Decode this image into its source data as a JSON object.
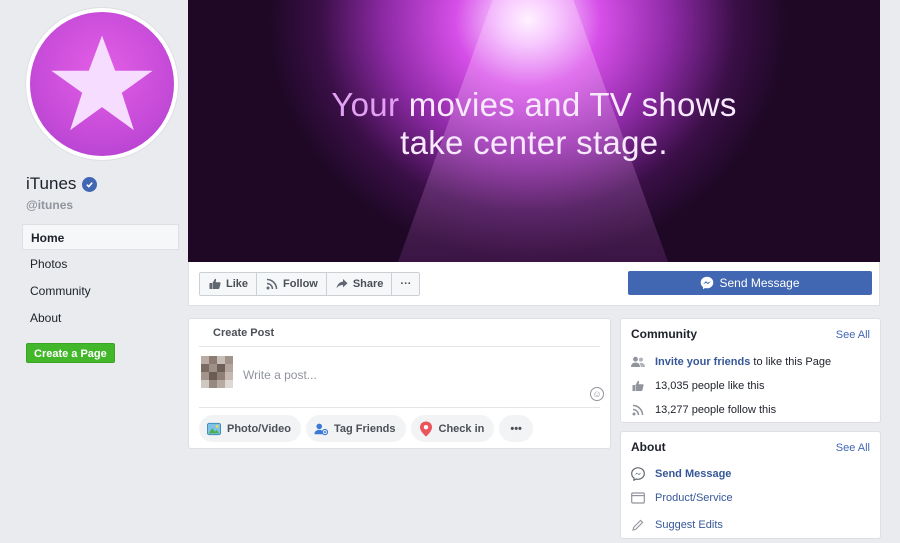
{
  "page": {
    "name": "iTunes",
    "handle": "@itunes"
  },
  "nav": {
    "items": [
      {
        "label": "Home",
        "active": true
      },
      {
        "label": "Photos"
      },
      {
        "label": "Community"
      },
      {
        "label": "About"
      }
    ],
    "create_page": "Create a Page"
  },
  "cover": {
    "line1_highlight": "Your",
    "line1_rest": " movies and TV shows",
    "line2": "take center stage."
  },
  "actions": {
    "like": "Like",
    "follow": "Follow",
    "share": "Share",
    "more": "···",
    "send_message": "Send Message"
  },
  "create_post": {
    "title": "Create Post",
    "placeholder": "Write a post...",
    "photo_video": "Photo/Video",
    "tag_friends": "Tag Friends",
    "check_in": "Check in",
    "more": "•••"
  },
  "community": {
    "title": "Community",
    "see_all": "See All",
    "invite_link": "Invite your friends",
    "invite_rest": " to like this Page",
    "likes": "13,035 people like this",
    "follows": "13,277 people follow this"
  },
  "about": {
    "title": "About",
    "see_all": "See All",
    "send_message": "Send Message",
    "category": "Product/Service",
    "suggest_edits": "Suggest Edits"
  },
  "colors": {
    "brand": "#4267b2",
    "avatar": "#c54bd8",
    "create_page": "#42b72a",
    "background": "#e9ebee"
  }
}
